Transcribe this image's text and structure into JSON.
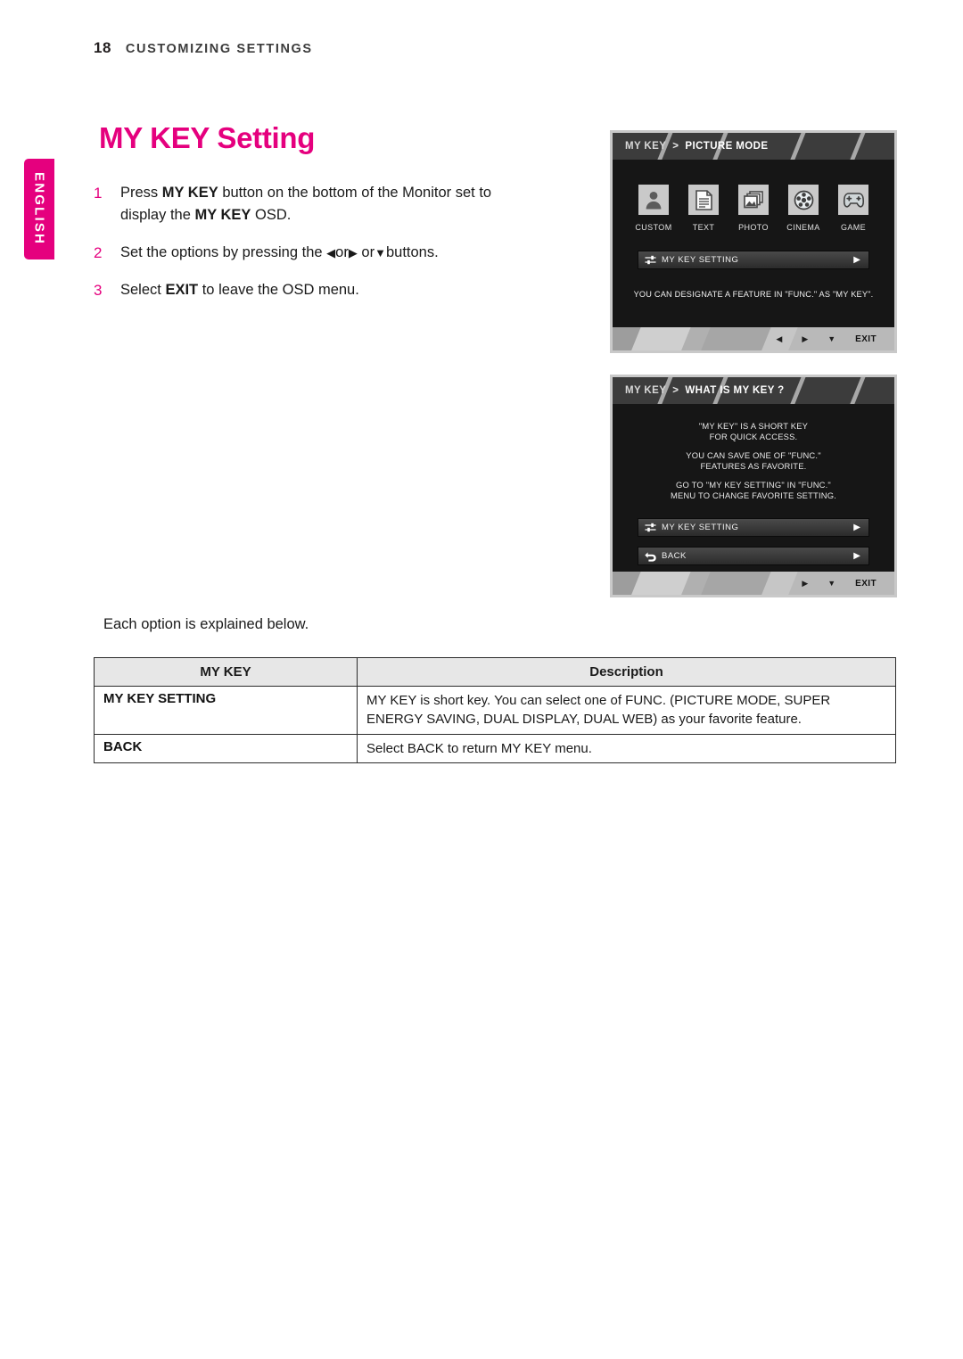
{
  "page": {
    "number": "18",
    "section": "CUSTOMIZING SETTINGS",
    "language_tab": "ENGLISH",
    "title": "MY KEY Setting",
    "accent_color": "#e5007e"
  },
  "steps": [
    {
      "num": "1",
      "html": "Press <b>MY KEY</b> button on the bottom of the Monitor set to display the <b>MY KEY</b> OSD."
    },
    {
      "num": "2",
      "html": "Set the options by pressing the <span class=\"arrowg\">◀</span>or<span class=\"arrowg\">▶</span> or<span class=\"arrowg\">▼</span>buttons."
    },
    {
      "num": "3",
      "html": "Select <b>EXIT</b> to leave the OSD menu."
    }
  ],
  "osd1": {
    "crumb": "MY KEY",
    "separator": ">",
    "title": "PICTURE MODE",
    "modes": [
      {
        "label": "CUSTOM",
        "icon": "person-icon"
      },
      {
        "label": "TEXT",
        "icon": "document-icon"
      },
      {
        "label": "PHOTO",
        "icon": "photo-icon"
      },
      {
        "label": "CINEMA",
        "icon": "film-reel-icon"
      },
      {
        "label": "GAME",
        "icon": "gamepad-icon"
      }
    ],
    "menu": {
      "label": "MY KEY SETTING",
      "icon": "sliders-icon",
      "arrow": "▶"
    },
    "note": "YOU CAN DESIGNATE A FEATURE IN \"FUNC.\" AS \"MY KEY\".",
    "keys": {
      "left": "◀",
      "right": "▶",
      "down": "▼",
      "exit": "EXIT"
    }
  },
  "osd2": {
    "crumb": "MY KEY",
    "separator": ">",
    "title": "WHAT IS MY KEY ?",
    "description": [
      "\"MY KEY\" IS A SHORT KEY\nFOR QUICK ACCESS.",
      "YOU CAN SAVE ONE OF \"FUNC.\"\nFEATURES AS FAVORITE.",
      "GO TO \"MY KEY SETTING\" IN \"FUNC.\"\nMENU TO CHANGE FAVORITE SETTING."
    ],
    "menu_items": [
      {
        "label": "MY KEY SETTING",
        "icon": "sliders-icon",
        "arrow": "▶"
      },
      {
        "label": "BACK",
        "icon": "back-arrow-icon",
        "arrow": "▶"
      }
    ],
    "keys": {
      "right": "▶",
      "down": "▼",
      "exit": "EXIT"
    }
  },
  "intro_line": "Each option is explained below.",
  "table": {
    "headers": [
      "MY KEY",
      "Description"
    ],
    "rows": [
      {
        "key": "MY KEY SETTING",
        "desc": "MY KEY is short key. You can select one of FUNC. (PICTURE MODE, SUPER ENERGY SAVING, DUAL DISPLAY, DUAL WEB) as your favorite feature."
      },
      {
        "key": "BACK",
        "desc": "Select BACK to return MY KEY menu."
      }
    ]
  }
}
